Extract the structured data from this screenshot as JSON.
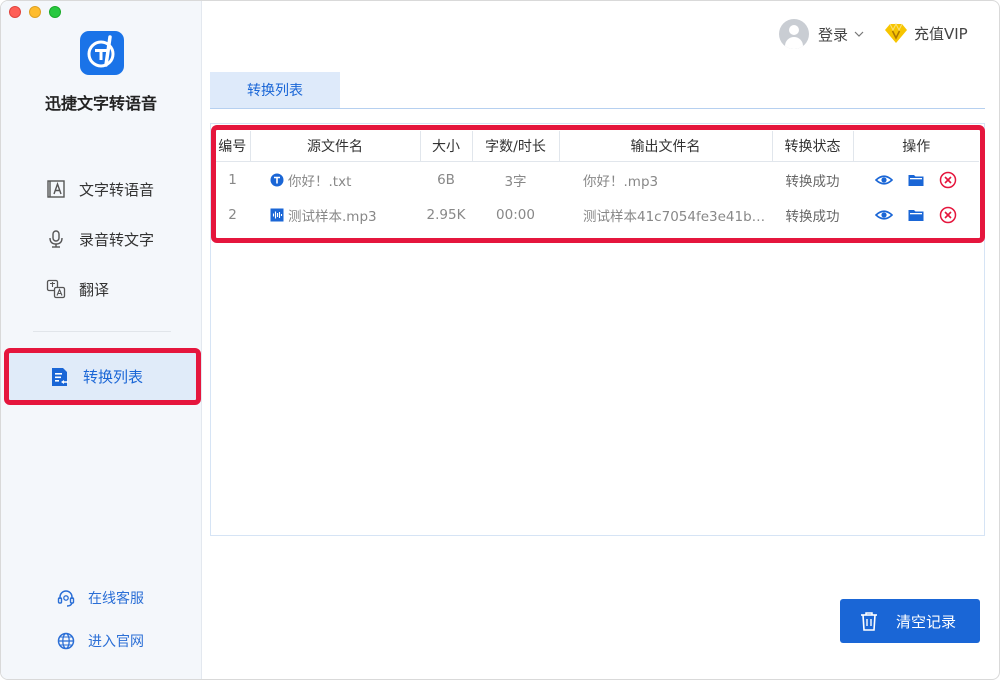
{
  "app": {
    "name": "迅捷文字转语音"
  },
  "sidebar": {
    "items": [
      {
        "label": "文字转语音",
        "icon": "text-to-speech-icon"
      },
      {
        "label": "录音转文字",
        "icon": "microphone-icon"
      },
      {
        "label": "翻译",
        "icon": "translate-icon"
      },
      {
        "label": "转换列表",
        "icon": "list-doc-icon",
        "active": true
      }
    ],
    "links": [
      {
        "label": "在线客服",
        "icon": "headset-icon"
      },
      {
        "label": "进入官网",
        "icon": "globe-icon"
      }
    ]
  },
  "header": {
    "login_label": "登录",
    "vip_label": "充值VIP"
  },
  "tabs": [
    {
      "label": "转换列表"
    }
  ],
  "table": {
    "columns": [
      "编号",
      "源文件名",
      "大小",
      "字数/时长",
      "输出文件名",
      "转换状态",
      "操作"
    ],
    "rows": [
      {
        "id": "1",
        "source": "你好！.txt",
        "source_icon": "text-file-icon",
        "size": "6B",
        "length": "3字",
        "output": "你好！.mp3",
        "status": "转换成功"
      },
      {
        "id": "2",
        "source": "测试样本.mp3",
        "source_icon": "audio-file-icon",
        "size": "2.95K",
        "length": "00:00",
        "output": "测试样本41c7054fe3e41b…",
        "status": "转换成功"
      }
    ]
  },
  "actions": {
    "clear_label": "清空记录"
  },
  "colors": {
    "accent": "#1a66d6",
    "highlight": "#e5163d",
    "delete": "#e5163d"
  }
}
